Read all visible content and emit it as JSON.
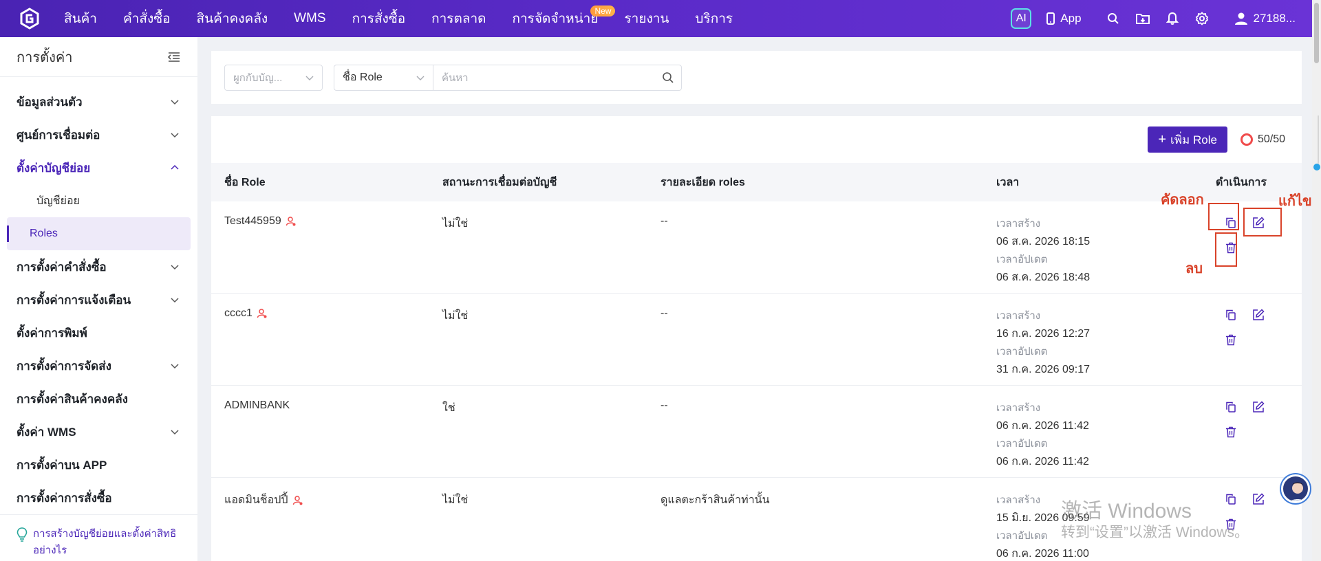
{
  "topnav": {
    "menu": [
      "สินค้า",
      "คำสั่งซื้อ",
      "สินค้าคงคลัง",
      "WMS",
      "การสั่งซื้อ",
      "การตลาด",
      "การจัดจำหน่าย",
      "รายงาน",
      "บริการ"
    ],
    "new_badge": "New",
    "ai_label": "AI",
    "app_label": "App",
    "user_label": "27188..."
  },
  "sidebar": {
    "title": "การตั้งค่า",
    "items": [
      {
        "label": "ข้อมูลส่วนตัว",
        "chevron": "down"
      },
      {
        "label": "ศูนย์การเชื่อมต่อ",
        "chevron": "down"
      },
      {
        "label": "ตั้งค่าบัญชีย่อย",
        "chevron": "up"
      }
    ],
    "subitems": [
      "บัญชีย่อย",
      "Roles"
    ],
    "items_after": [
      {
        "label": "การตั้งค่าคำสั่งซื้อ",
        "chevron": "down"
      },
      {
        "label": "การตั้งค่าการแจ้งเตือน",
        "chevron": "down"
      },
      {
        "label": "ตั้งค่าการพิมพ์",
        "chevron": ""
      },
      {
        "label": "การตั้งค่าการจัดส่ง",
        "chevron": "down"
      },
      {
        "label": "การตั้งค่าสินค้าคงคลัง",
        "chevron": ""
      },
      {
        "label": "ตั้งค่า WMS",
        "chevron": "down"
      },
      {
        "label": "การตั้งค่าบน APP",
        "chevron": ""
      },
      {
        "label": "การตั้งค่าการสั่งซื้อ",
        "chevron": ""
      }
    ],
    "help_text_1": "การสร้างบัญชีย่อยและตั้งค่าสิทธิ",
    "help_text_2": "อย่างไร"
  },
  "filter": {
    "select1_placeholder": "ผูกกับบัญ...",
    "select2_value": "ชื่อ Role",
    "search_placeholder": "ค้นหา"
  },
  "toolbar": {
    "add_label": "เพิ่ม Role",
    "quota": "50/50"
  },
  "table": {
    "headers": [
      "ชื่อ Role",
      "สถานะการเชื่อมต่อบัญชี",
      "รายละเอียด roles",
      "เวลา",
      "ดำเนินการ"
    ],
    "created_label": "เวลาสร้าง",
    "updated_label": "เวลาอัปเดต",
    "rows": [
      {
        "name": "Test445959",
        "linked": "ไม่ใช่",
        "details": "--",
        "created": "06 ส.ค. 2026 18:15",
        "updated": "06 ส.ค. 2026 18:48",
        "user_icon": true
      },
      {
        "name": "cccc1",
        "linked": "ไม่ใช่",
        "details": "--",
        "created": "16 ก.ค. 2026 12:27",
        "updated": "31 ก.ค. 2026 09:17",
        "user_icon": true
      },
      {
        "name": "ADMINBANK",
        "linked": "ใช่",
        "details": "--",
        "created": "06 ก.ค. 2026 11:42",
        "updated": "06 ก.ค. 2026 11:42",
        "user_icon": false
      },
      {
        "name": "แอดมินช็อปปี้",
        "linked": "ไม่ใช่",
        "details": "ดูแลตะกร้าสินค้าท่านั้น",
        "created": "15 มิ.ย. 2026 09:59",
        "updated": "06 ก.ค. 2026 11:00",
        "user_icon": true
      }
    ]
  },
  "annotations": {
    "copy": "คัดลอก",
    "edit": "แก้ไข",
    "delete": "ลบ"
  },
  "watermark": {
    "line1": "激活 Windows",
    "line2": "转到“设置”以激活 Windows。"
  },
  "colors": {
    "brand": "#4b26b8",
    "nav_gradient_start": "#4a23b3",
    "annotation": "#d9432a",
    "quota_ring": "#f04b4b"
  }
}
